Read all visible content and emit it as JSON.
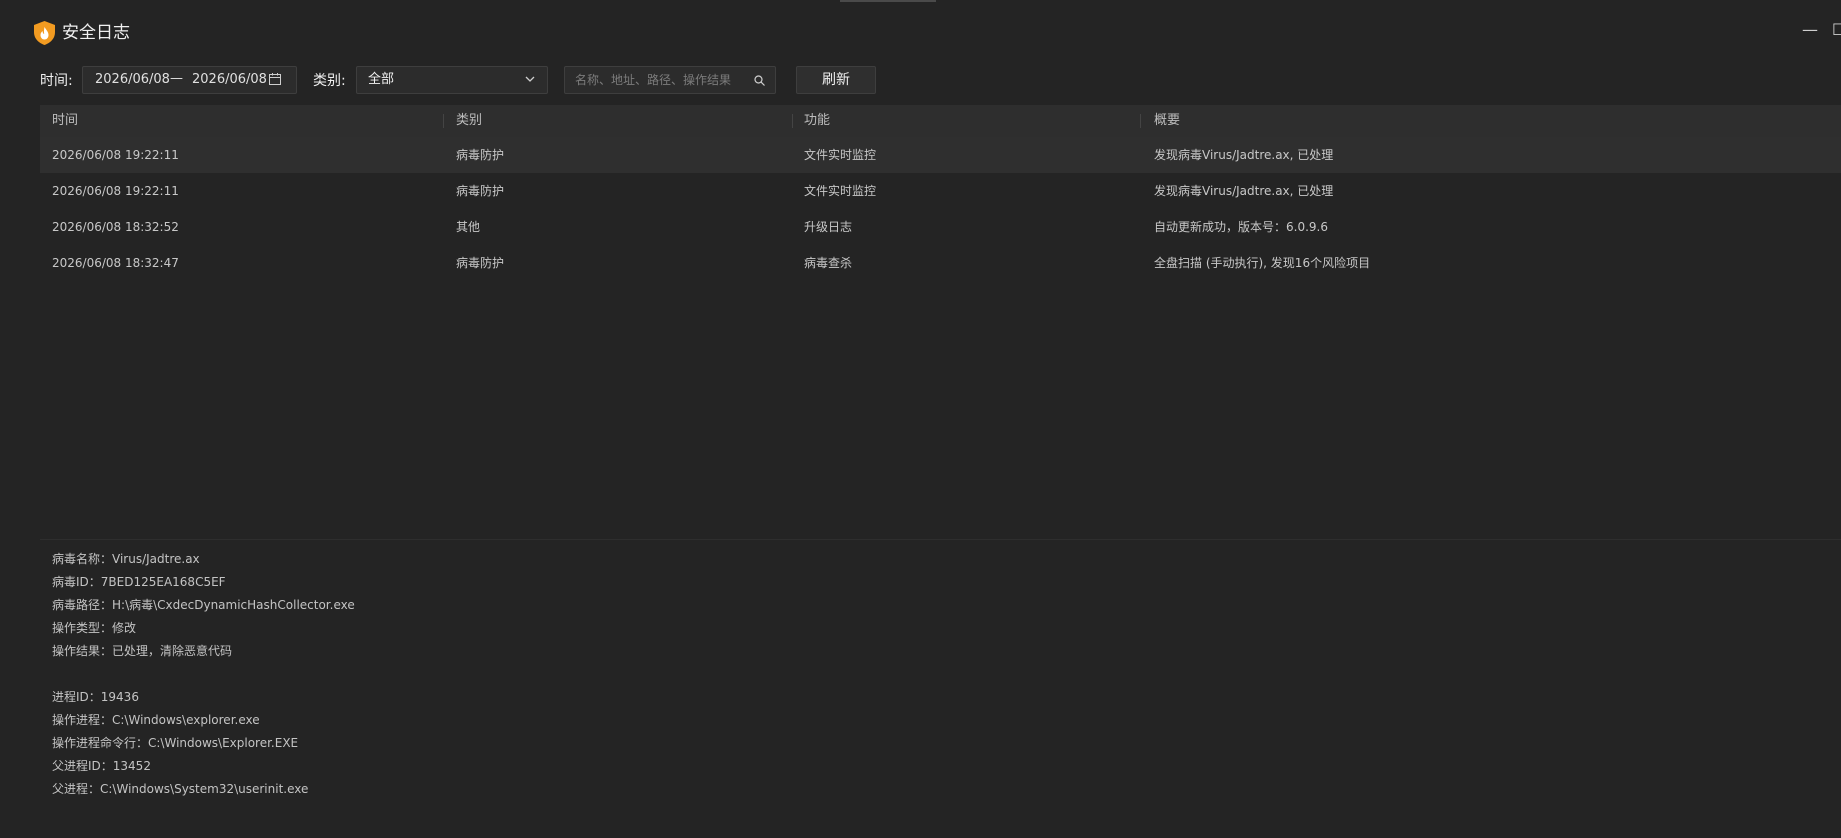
{
  "window": {
    "title": "安全日志",
    "minimize_glyph": "—",
    "maximize_glyph": "☐",
    "logo_icon": "shield-flame-icon",
    "accent_color": "#f29b21"
  },
  "filters": {
    "time_label": "时间:",
    "date_start": "2026/06/08",
    "date_separator": "—",
    "date_end": "2026/06/08",
    "category_label": "类别:",
    "category_value": "全部",
    "search_placeholder": "名称、地址、路径、操作结果",
    "refresh_label": "刷新"
  },
  "table": {
    "columns": [
      "时间",
      "类别",
      "功能",
      "概要"
    ],
    "rows": [
      {
        "time": "2026/06/08 19:22:11",
        "category": "病毒防护",
        "function": "文件实时监控",
        "summary": "发现病毒Virus/Jadtre.ax, 已处理"
      },
      {
        "time": "2026/06/08 19:22:11",
        "category": "病毒防护",
        "function": "文件实时监控",
        "summary": "发现病毒Virus/Jadtre.ax, 已处理"
      },
      {
        "time": "2026/06/08 18:32:52",
        "category": "其他",
        "function": "升级日志",
        "summary": "自动更新成功，版本号：6.0.9.6"
      },
      {
        "time": "2026/06/08 18:32:47",
        "category": "病毒防护",
        "function": "病毒查杀",
        "summary": "全盘扫描 (手动执行), 发现16个风险项目"
      }
    ]
  },
  "details": {
    "lines": [
      "病毒名称：Virus/Jadtre.ax",
      "病毒ID：7BED125EA168C5EF",
      "病毒路径：H:\\病毒\\CxdecDynamicHashCollector.exe",
      "操作类型：修改",
      "操作结果：已处理，清除恶意代码",
      "进程ID：19436",
      "操作进程：C:\\Windows\\explorer.exe",
      "操作进程命令行：C:\\Windows\\Explorer.EXE",
      "父进程ID：13452",
      "父进程：C:\\Windows\\System32\\userinit.exe"
    ]
  }
}
